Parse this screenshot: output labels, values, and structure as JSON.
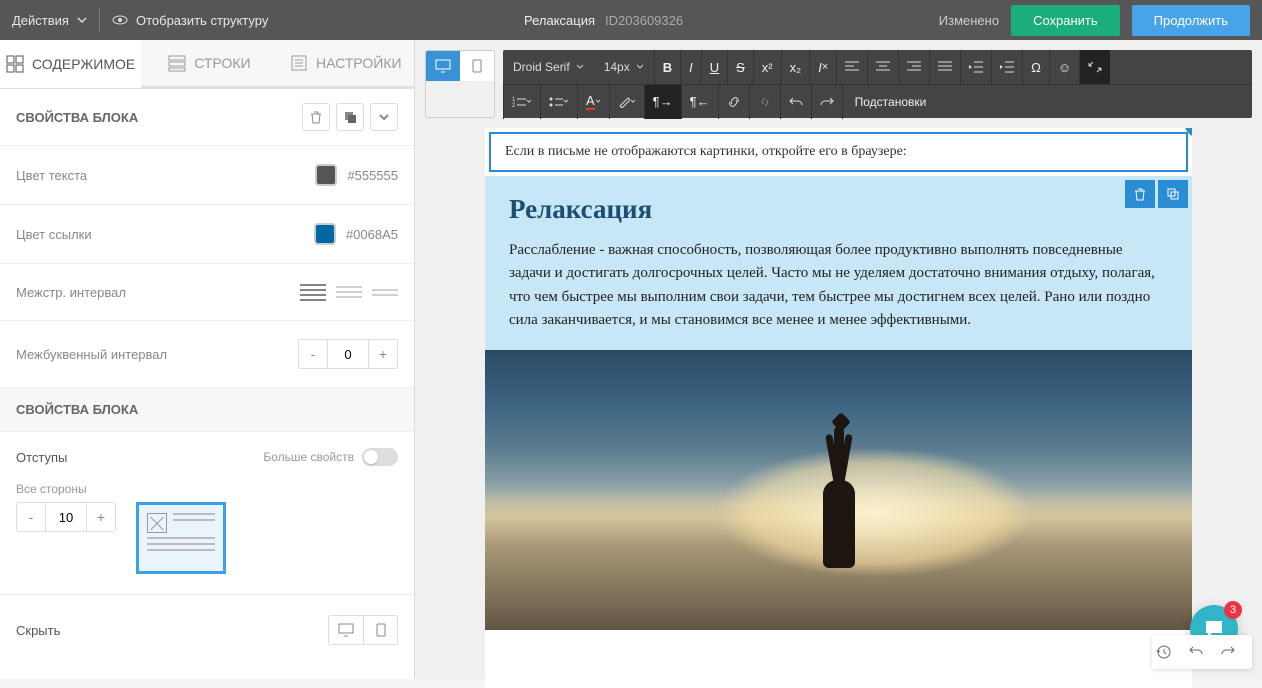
{
  "topbar": {
    "actions_label": "Действия",
    "structure_label": "Отобразить структуру",
    "doc_title": "Релаксация",
    "doc_id": "ID203609326",
    "changed_label": "Изменено",
    "save_label": "Сохранить",
    "continue_label": "Продолжить"
  },
  "side_tabs": {
    "content": "СОДЕРЖИМОЕ",
    "rows": "СТРОКИ",
    "settings": "НАСТРОЙКИ"
  },
  "props": {
    "block_header": "СВОЙСТВА БЛОКА",
    "text_color_label": "Цвет текста",
    "text_color_value": "#555555",
    "link_color_label": "Цвет ссылки",
    "link_color_value": "#0068A5",
    "line_height_label": "Межстр. интервал",
    "letter_spacing_label": "Межбуквенный интервал",
    "letter_spacing_value": "0",
    "block_header2": "СВОЙСТВА БЛОКА",
    "padding_label": "Отступы",
    "more_props_label": "Больше свойств",
    "all_sides_label": "Все стороны",
    "all_sides_value": "10",
    "hide_label": "Скрыть"
  },
  "toolbar": {
    "font_family": "Droid Serif",
    "font_size": "14px",
    "merge_tags": "Подстановки"
  },
  "email": {
    "preheader": "Если в письме не отображаются картинки, откройте его в браузере:",
    "heading": "Релаксация",
    "body": "Расслабление - важная способность, позволяющая более продуктивно выполнять повседневные задачи и достигать долгосрочных целей. Часто мы не уделяем достаточно внимания отдыху, полагая, что чем быстрее мы выполним свои задачи, тем быстрее мы достигнем всех целей. Рано или поздно сила заканчивается, и мы становимся все менее и менее эффективными."
  },
  "chat_badge": "3",
  "colors": {
    "text_swatch": "#555555",
    "link_swatch": "#0068A5"
  }
}
